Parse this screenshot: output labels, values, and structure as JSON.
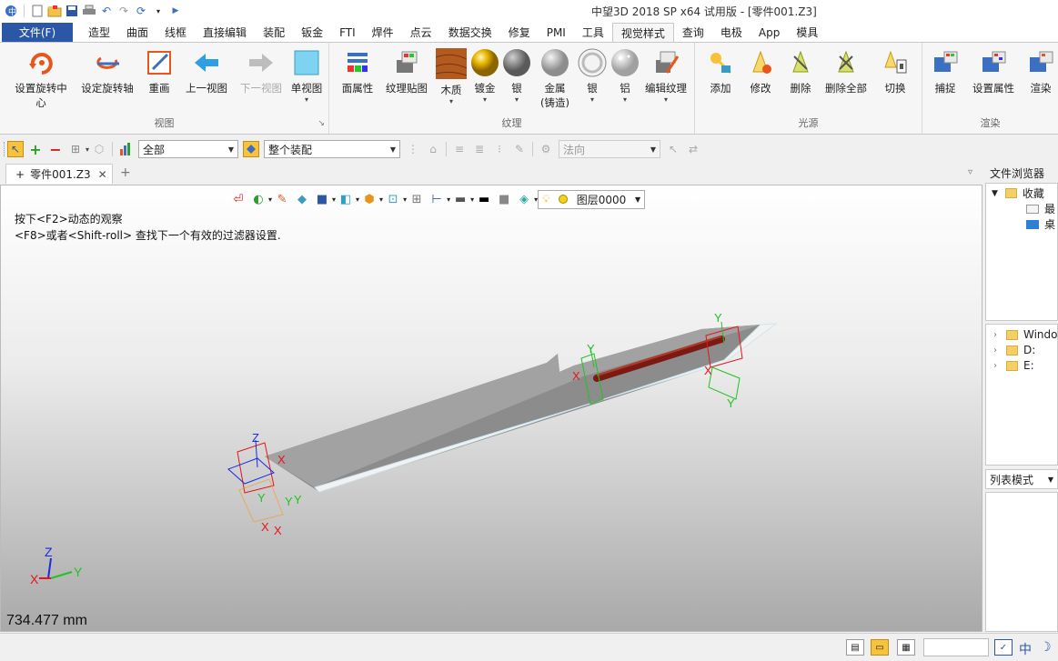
{
  "window": {
    "title": "中望3D 2018 SP x64 试用版 - [零件001.Z3]"
  },
  "quick_access": [
    "app-logo-icon",
    "new-file-icon",
    "open-file-icon",
    "save-icon",
    "print-icon",
    "undo-icon",
    "redo-icon",
    "rebuild-icon",
    "customize-icon",
    "expand-icon"
  ],
  "menu": {
    "file": "文件(F)",
    "tabs": [
      "造型",
      "曲面",
      "线框",
      "直接编辑",
      "装配",
      "钣金",
      "FTI",
      "焊件",
      "点云",
      "数据交换",
      "修复",
      "PMI",
      "工具",
      "视觉样式",
      "查询",
      "电极",
      "App",
      "模具"
    ],
    "active": "视觉样式"
  },
  "ribbon": {
    "view": {
      "label": "视图",
      "set_rotation_center": "设置旋转中",
      "set_rotation_center_2": "心",
      "set_rotation_axis": "设定旋转轴",
      "redraw": "重画",
      "prev_view": "上一视图",
      "next_view": "下一视图",
      "single_view": "单视图"
    },
    "texture": {
      "label": "纹理",
      "face_prop": "面属性",
      "texture_map": "纹理贴图",
      "wood": "木质",
      "gold": "镀金",
      "silver": "银",
      "metal": "金属",
      "metal_sub": "(铸造)",
      "silver2": "银",
      "aluminum": "铝",
      "edit_texture": "编辑纹理"
    },
    "light": {
      "label": "光源",
      "add": "添加",
      "modify": "修改",
      "delete": "删除",
      "delete_all": "删除全部",
      "switch": "切换"
    },
    "render": {
      "label": "渲染",
      "capture": "捕捉",
      "set_props": "设置属性",
      "render": "渲染"
    }
  },
  "toolbar": {
    "filter_value": "全部",
    "assembly_value": "整个装配",
    "direction_placeholder": "法向"
  },
  "doc_tab": {
    "label": "零件001.Z3",
    "close": "✕",
    "add": "+"
  },
  "viewport": {
    "layer": "图层0000",
    "hint_line1": "按下<F2>动态的观察",
    "hint_line2": "<F8>或者<Shift-roll> 查找下一个有效的过滤器设置.",
    "measure": "734.477 mm",
    "axis_labels": {
      "x": "X",
      "y": "Y",
      "z": "Z"
    }
  },
  "file_browser": {
    "title": "文件浏览器",
    "favorites": "收藏",
    "recent": "最",
    "desktop": "桌",
    "drives": [
      "Windo",
      "D:",
      "E:"
    ],
    "list_mode": "列表模式"
  },
  "statusbar": {
    "ime_lang": "中"
  },
  "colors": {
    "file_tab": "#2b57a6",
    "rod": "#7a1a12",
    "blade": "#8c8c8c",
    "axis_x": "#e8141a",
    "axis_y": "#22c222",
    "axis_z": "#1a2be0"
  }
}
